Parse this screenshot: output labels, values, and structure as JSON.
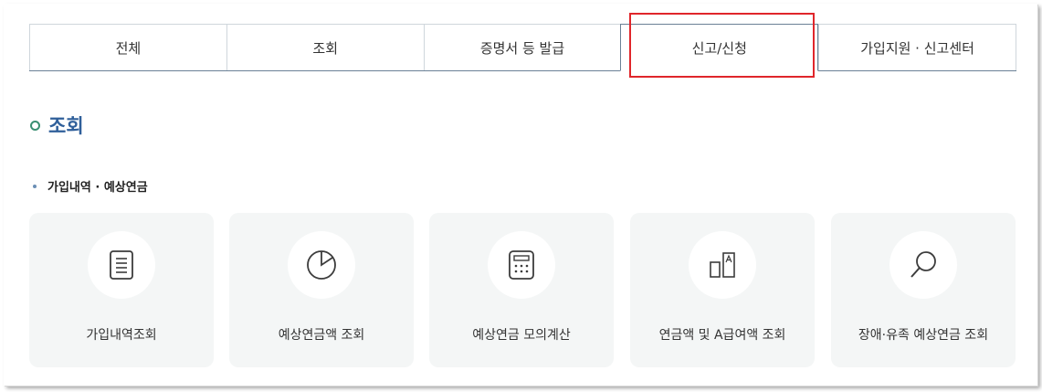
{
  "tabs": [
    {
      "label": "전체",
      "active": false
    },
    {
      "label": "조회",
      "active": false
    },
    {
      "label": "증명서 등 발급",
      "active": false
    },
    {
      "label": "신고/신청",
      "active": true
    },
    {
      "label": "가입지원 · 신고센터",
      "active": false
    }
  ],
  "highlight_color": "#e0262b",
  "section": {
    "title": "조회"
  },
  "subsection": {
    "title": "가입내역 · 예상연금"
  },
  "cards": [
    {
      "label": "가입내역조회",
      "icon": "document-icon"
    },
    {
      "label": "예상연금액 조회",
      "icon": "pie-chart-icon"
    },
    {
      "label": "예상연금 모의계산",
      "icon": "calculator-icon"
    },
    {
      "label": "연금액 및 A급여액 조회",
      "icon": "compare-bars-icon"
    },
    {
      "label": "장애·유족 예상연금 조회",
      "icon": "magnifier-icon"
    }
  ]
}
